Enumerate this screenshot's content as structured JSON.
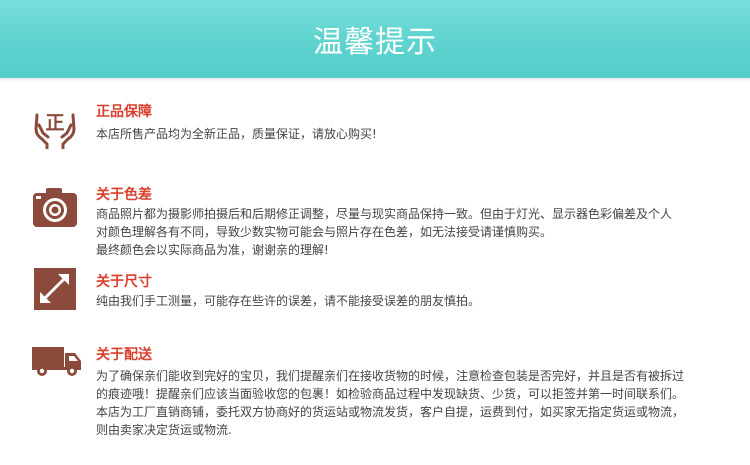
{
  "header": {
    "title": "温馨提示"
  },
  "colors": {
    "accent": "#5ed3cf",
    "title_red": "#d9402e",
    "icon_brown": "#8b4a3b"
  },
  "sections": [
    {
      "icon": "genuine-hands-icon",
      "icon_char": "正",
      "title": "正品保障",
      "lines": [
        "本店所售产品均为全新正品，质量保证，请放心购买!"
      ]
    },
    {
      "icon": "camera-icon",
      "title": "关于色差",
      "lines": [
        "商品照片都为摄影师拍摄后和后期修正调整，尽量与现实商品保持一致。但由于灯光、显示器色彩偏差及个人",
        "对颜色理解各有不同，导致少数实物可能会与照片存在色差，如无法接受请谨慎购买。",
        "最终颜色会以实际商品为准，谢谢亲的理解!"
      ]
    },
    {
      "icon": "measure-arrow-icon",
      "title": "关于尺寸",
      "lines": [
        "纯由我们手工测量，可能存在些许的误差，请不能接受误差的朋友慎拍。"
      ]
    },
    {
      "icon": "delivery-truck-icon",
      "title": "关于配送",
      "lines": [
        "为了确保亲们能收到完好的宝贝，我们提醒亲们在接收货物的时候，注意检查包装是否完好，并且是否有被拆过",
        "的痕迹哦！提醒亲们应该当面验收您的包裹！如检验商品过程中发现缺货、少货，可以拒签并第一时间联系们。",
        "本店为工厂直销商铺，委托双方协商好的货运站或物流发货，客户自提，运费到付，如买家无指定货运或物流，",
        "则由卖家决定货运或物流."
      ]
    }
  ]
}
